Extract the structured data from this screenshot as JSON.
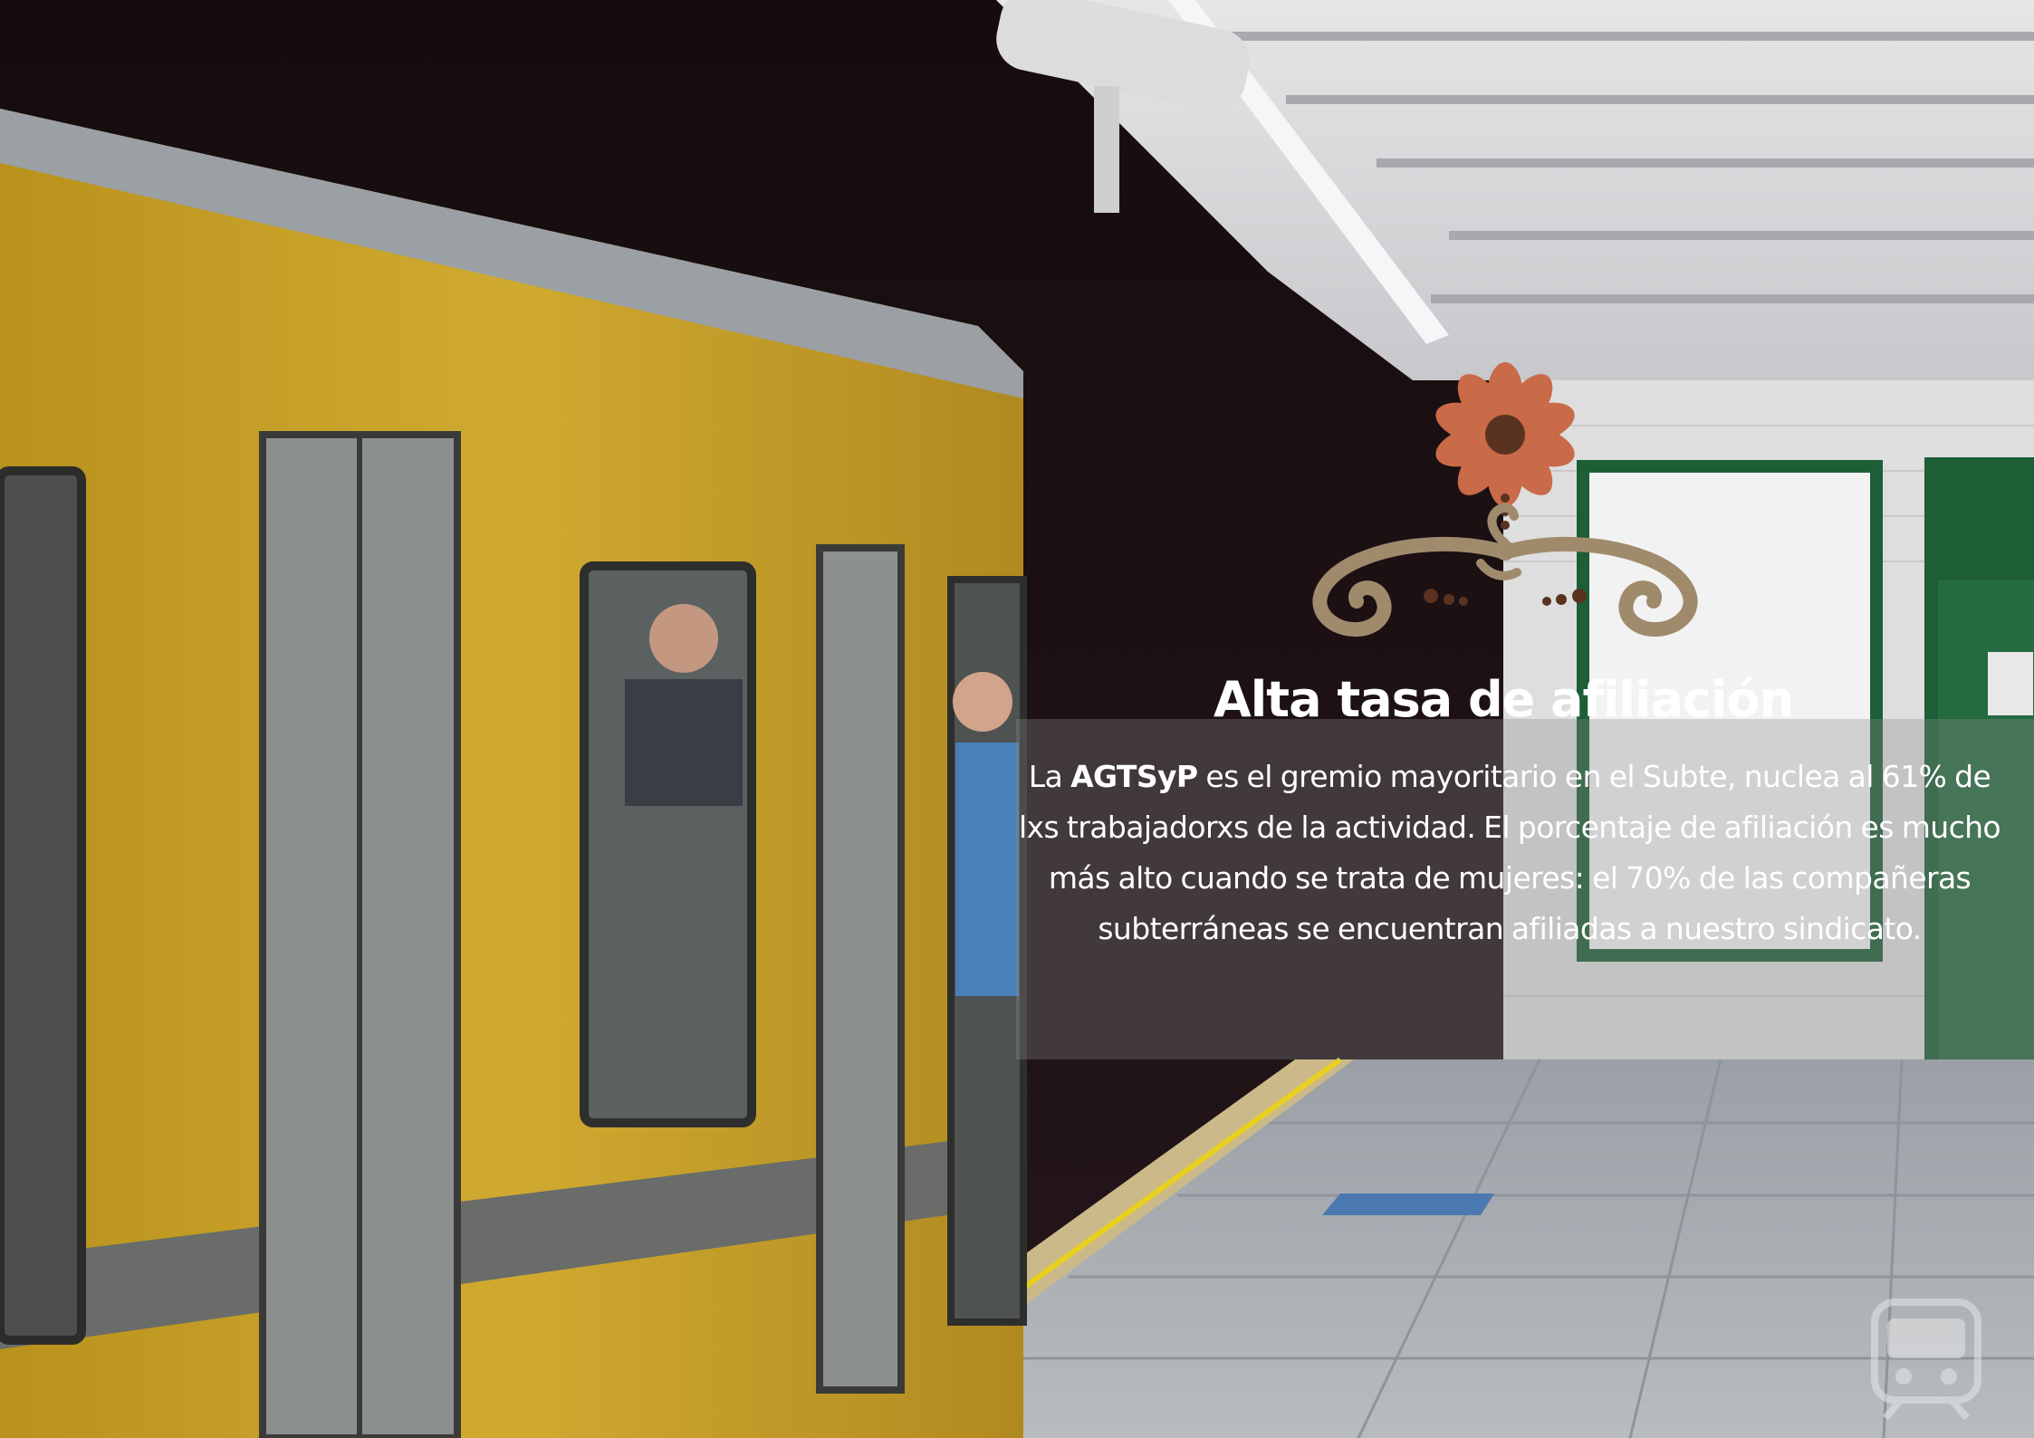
{
  "heading": {
    "title": "Alta tasa de afiliación"
  },
  "paragraph": {
    "intro": "La ",
    "union_name": "AGTSyP",
    "text": " es el gremio mayoritario en el Subte, nuclea al 61% de lxs trabajadorxs de la actividad. El porcentaje de afiliación es mucho más alto cuando se trata de mujeres: el  70% de las compañeras subterráneas se encuentran afiliadas a nuestro sindicato."
  },
  "colors": {
    "train_yellow": "#c9a227",
    "flower_orange": "#c96a48",
    "flower_center": "#5a3220",
    "scroll_tan": "#a08a6c",
    "tunnel_dark": "#1c1012",
    "station_tile": "#d8d8d6",
    "station_green": "#1d5e36"
  },
  "icons": {
    "ornament": "flower-scroll-ornament-icon",
    "logo": "subway-train-logo-icon"
  }
}
